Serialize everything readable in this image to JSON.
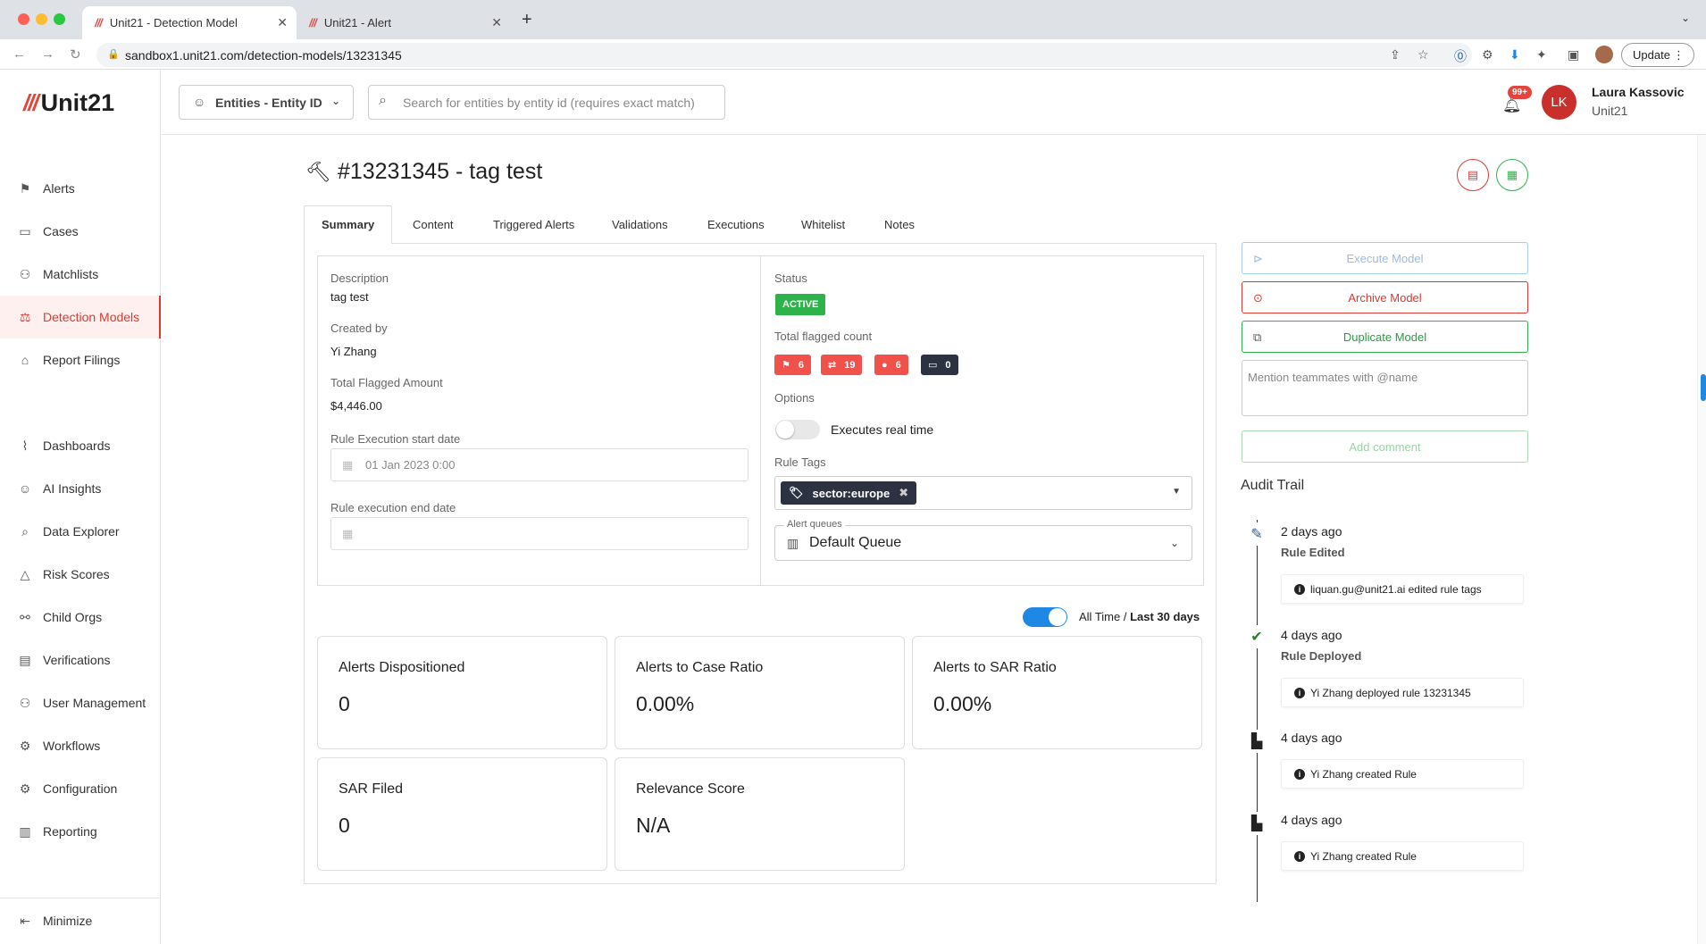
{
  "browser": {
    "tabs": [
      {
        "title": "Unit21 - Detection Model"
      },
      {
        "title": "Unit21 - Alert"
      }
    ],
    "url": "sandbox1.unit21.com/detection-models/13231345",
    "update_label": "Update"
  },
  "brand": {
    "name": "Unit21",
    "accent": "#e3443c"
  },
  "sidebar": {
    "items": [
      {
        "label": "Alerts",
        "icon": "flag-icon"
      },
      {
        "label": "Cases",
        "icon": "briefcase-icon"
      },
      {
        "label": "Matchlists",
        "icon": "user-x-icon"
      },
      {
        "label": "Detection Models",
        "icon": "scale-icon"
      },
      {
        "label": "Report Filings",
        "icon": "bank-icon"
      },
      {
        "label": "Dashboards",
        "icon": "chart-line-icon"
      },
      {
        "label": "AI Insights",
        "icon": "robot-icon"
      },
      {
        "label": "Data Explorer",
        "icon": "search-data-icon"
      },
      {
        "label": "Risk Scores",
        "icon": "warning-icon"
      },
      {
        "label": "Child Orgs",
        "icon": "org-tree-icon"
      },
      {
        "label": "Verifications",
        "icon": "id-card-icon"
      },
      {
        "label": "User Management",
        "icon": "users-icon"
      },
      {
        "label": "Workflows",
        "icon": "gear-icon"
      },
      {
        "label": "Configuration",
        "icon": "gear-icon"
      },
      {
        "label": "Reporting",
        "icon": "report-icon"
      }
    ],
    "minimize_label": "Minimize"
  },
  "topbar": {
    "entity_select": "Entities - Entity ID",
    "search_placeholder": "Search for entities by entity id (requires exact match)",
    "notifications_badge": "99+",
    "user": {
      "initials": "LK",
      "name": "Laura Kassovic",
      "org": "Unit21"
    }
  },
  "model": {
    "title": "#13231345 - tag test",
    "tabs": [
      "Summary",
      "Content",
      "Triggered Alerts",
      "Validations",
      "Executions",
      "Whitelist",
      "Notes"
    ],
    "active_tab": "Summary",
    "description_label": "Description",
    "description": "tag test",
    "created_by_label": "Created by",
    "created_by": "Yi Zhang",
    "flagged_amount_label": "Total Flagged Amount",
    "flagged_amount": "$4,446.00",
    "start_date_label": "Rule Execution start date",
    "start_date": "01 Jan 2023 0:00",
    "end_date_label": "Rule execution end date",
    "end_date": "",
    "status_label": "Status",
    "status": "ACTIVE",
    "flagged_count_label": "Total flagged count",
    "flagged_counts": [
      {
        "icon": "flag-icon",
        "value": "6",
        "color": "#f0524b"
      },
      {
        "icon": "transfer-icon",
        "value": "19",
        "color": "#f0524b"
      },
      {
        "icon": "person-icon",
        "value": "6",
        "color": "#f0524b"
      },
      {
        "icon": "card-icon",
        "value": "0",
        "color": "#2c3242"
      }
    ],
    "options_label": "Options",
    "realtime_label": "Executes real time",
    "realtime_on": false,
    "rule_tags_label": "Rule Tags",
    "rule_tag": "sector:europe",
    "alert_queues_label": "Alert queues",
    "alert_queue": "Default Queue"
  },
  "range": {
    "all_time": "All Time /",
    "last_30": "Last 30 days"
  },
  "stats": [
    {
      "title": "Alerts Dispositioned",
      "value": "0"
    },
    {
      "title": "Alerts to Case Ratio",
      "value": "0.00%"
    },
    {
      "title": "Alerts to SAR Ratio",
      "value": "0.00%"
    },
    {
      "title": "SAR Filed",
      "value": "0"
    },
    {
      "title": "Relevance Score",
      "value": "N/A"
    }
  ],
  "actions": {
    "execute": "Execute Model",
    "archive": "Archive Model",
    "duplicate": "Duplicate Model",
    "mention_placeholder": "Mention teammates with @name",
    "add_comment": "Add comment"
  },
  "audit": {
    "title": "Audit Trail",
    "events": [
      {
        "when": "2 days ago",
        "event": "Rule Edited",
        "note": "liquan.gu@unit21.ai edited rule tags",
        "icon": "pencil-icon"
      },
      {
        "when": "4 days ago",
        "event": "Rule Deployed",
        "note": "Yi Zhang deployed rule 13231345",
        "icon": "check-icon"
      },
      {
        "when": "4 days ago",
        "event": "",
        "note": "Yi Zhang created Rule",
        "icon": "briefcase-icon"
      },
      {
        "when": "4 days ago",
        "event": "",
        "note": "Yi Zhang created Rule",
        "icon": "briefcase-icon"
      }
    ]
  },
  "colors": {
    "danger": "#d93b33",
    "success": "#2db34a",
    "primary": "#1e88e5",
    "dark": "#2c3242"
  }
}
